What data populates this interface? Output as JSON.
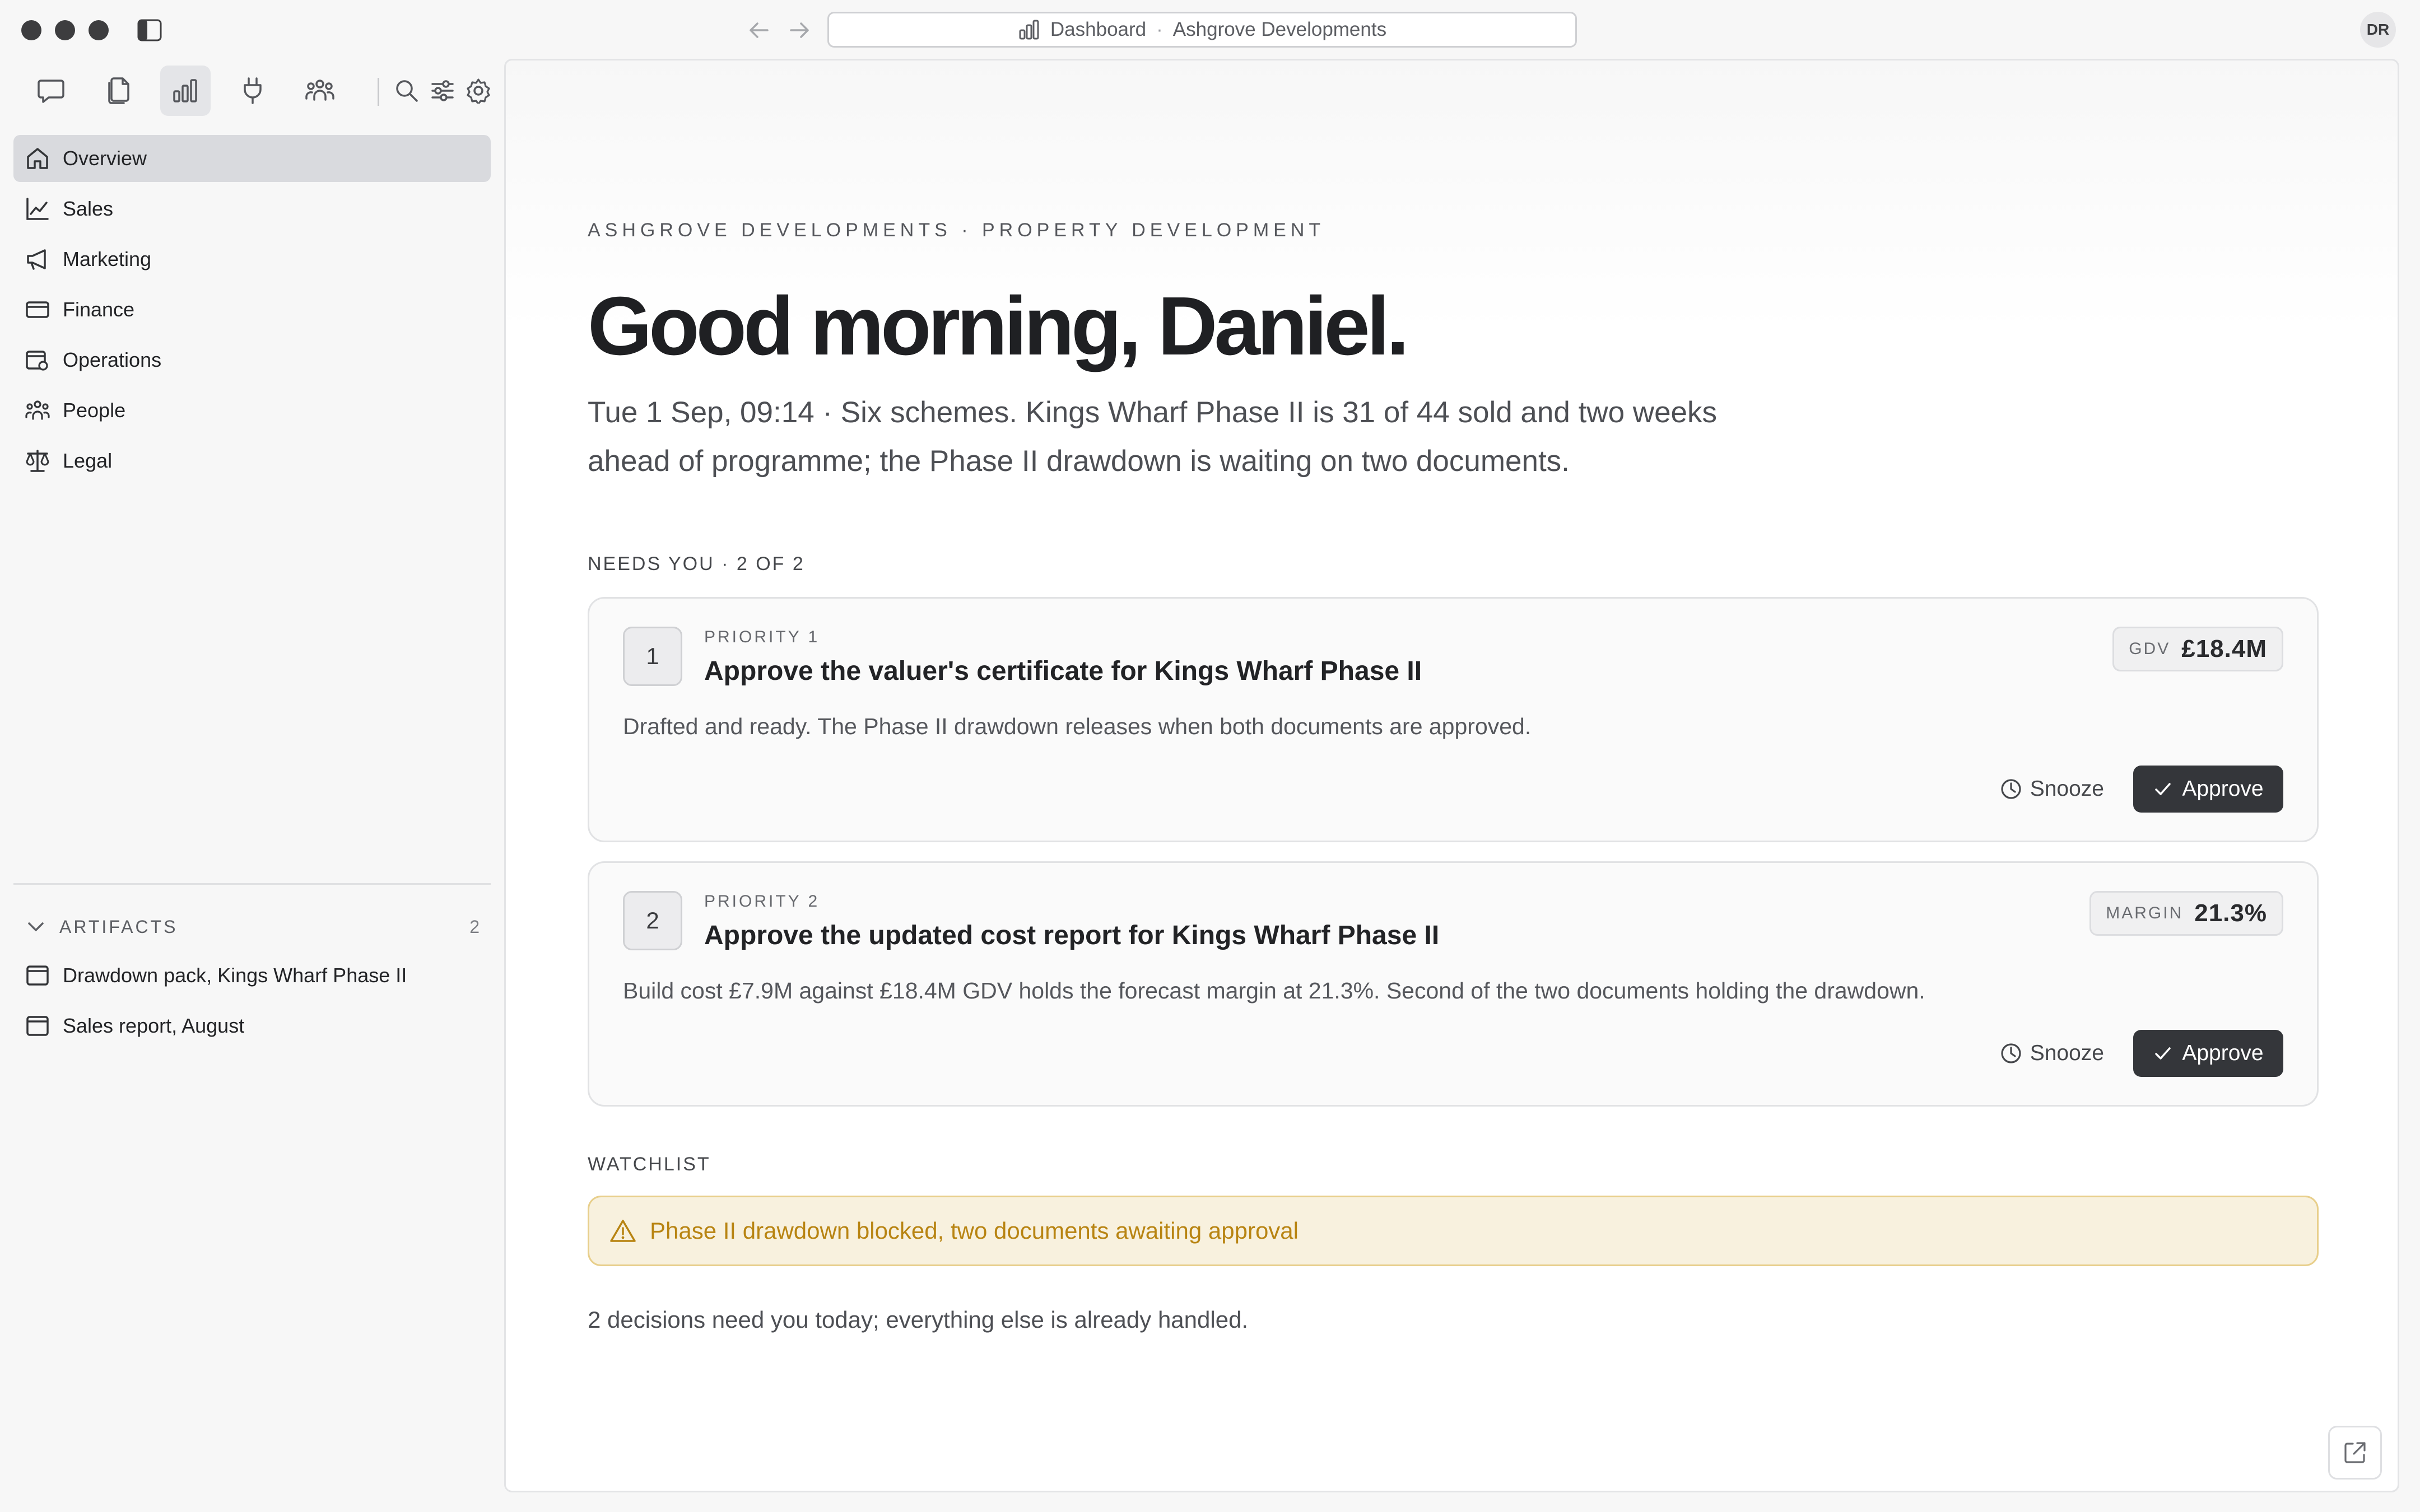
{
  "window": {
    "address": {
      "page": "Dashboard",
      "separator": "·",
      "org": "Ashgrove Developments"
    },
    "avatar_initials": "DR"
  },
  "toolbar": {
    "tools": [
      "chat-icon",
      "documents-icon",
      "dashboard-icon",
      "plug-icon",
      "team-icon"
    ],
    "active_tool": "dashboard-icon",
    "utility": [
      "search-icon",
      "sliders-icon",
      "gear-icon"
    ]
  },
  "sidebar": {
    "nav": [
      {
        "label": "Overview",
        "icon": "home-icon",
        "active": true
      },
      {
        "label": "Sales",
        "icon": "chart-line-icon"
      },
      {
        "label": "Marketing",
        "icon": "megaphone-icon"
      },
      {
        "label": "Finance",
        "icon": "card-icon"
      },
      {
        "label": "Operations",
        "icon": "operations-icon"
      },
      {
        "label": "People",
        "icon": "people-icon"
      },
      {
        "label": "Legal",
        "icon": "scales-icon"
      }
    ],
    "artifacts": {
      "label": "ARTIFACTS",
      "count": "2",
      "items": [
        {
          "label": "Drawdown pack, Kings Wharf Phase II"
        },
        {
          "label": "Sales report, August"
        }
      ]
    }
  },
  "main": {
    "eyebrow": "ASHGROVE DEVELOPMENTS · PROPERTY DEVELOPMENT",
    "greeting": "Good morning, Daniel.",
    "summary": "Tue 1 Sep, 09:14 · Six schemes. Kings Wharf Phase II is 31 of 44 sold and two weeks ahead of programme; the Phase II drawdown is waiting on two documents.",
    "needs_you_label": "NEEDS YOU · 2 OF 2",
    "cards": [
      {
        "number": "1",
        "priority": "PRIORITY 1",
        "title": "Approve the valuer's certificate for Kings Wharf Phase II",
        "description": "Drafted and ready. The Phase II drawdown releases when both documents are approved.",
        "metric_label": "GDV",
        "metric_value": "£18.4M",
        "snooze_label": "Snooze",
        "approve_label": "Approve"
      },
      {
        "number": "2",
        "priority": "PRIORITY 2",
        "title": "Approve the updated cost report for Kings Wharf Phase II",
        "description": "Build cost £7.9M against £18.4M GDV holds the forecast margin at 21.3%. Second of the two documents holding the drawdown.",
        "metric_label": "MARGIN",
        "metric_value": "21.3%",
        "snooze_label": "Snooze",
        "approve_label": "Approve"
      }
    ],
    "watchlist_label": "WATCHLIST",
    "watchlist_item": "Phase II drawdown blocked, two documents awaiting approval",
    "footer_note": "2 decisions need you today; everything else is already handled.",
    "colors": {
      "approve_bg": "#34363a",
      "warning_text": "#b88412",
      "warning_bg": "#f8f1de",
      "active_nav": "#d9dade"
    }
  }
}
